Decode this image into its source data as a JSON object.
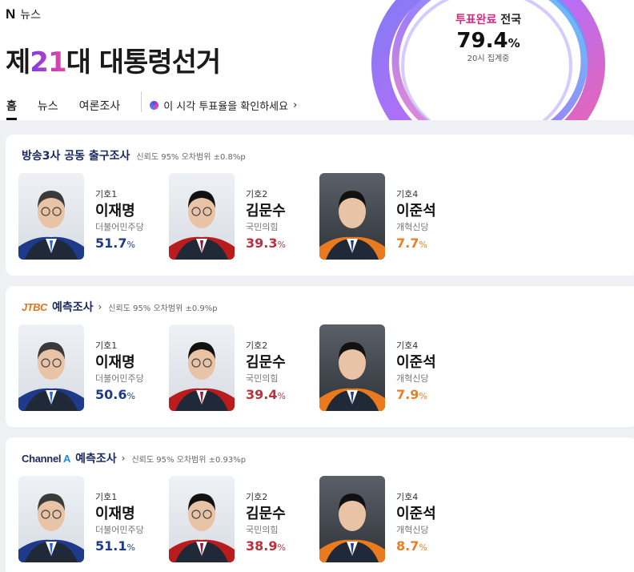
{
  "header": {
    "brand_logo": "N",
    "brand_label": "뉴스",
    "title_prefix": "제",
    "title_number": "21",
    "title_suffix": "대 대통령선거",
    "turnout": {
      "label_accent": "투표완료",
      "label_rest": " 전국",
      "rate": "79.4",
      "rate_unit": "%",
      "status": "20시 집계중"
    },
    "tabs": [
      {
        "label": "홈",
        "active": true
      },
      {
        "label": "뉴스",
        "active": false
      },
      {
        "label": "여론조사",
        "active": false
      }
    ],
    "promo_label": "이 시각 투표율을 확인하세요",
    "promo_arrow": "›"
  },
  "colors": {
    "candidate_1": "#1d3a8f",
    "candidate_2": "#c0303c",
    "candidate_4": "#e87f2a"
  },
  "polls": [
    {
      "source": "방송3사 공동 출구조사",
      "note": "신뢰도 95% 오차범위 ±0.8%p",
      "candidates": [
        {
          "number": "기호1",
          "name": "이재명",
          "party": "더불어민주당",
          "value": "51.7",
          "unit": "%"
        },
        {
          "number": "기호2",
          "name": "김문수",
          "party": "국민의힘",
          "value": "39.3",
          "unit": "%"
        },
        {
          "number": "기호4",
          "name": "이준석",
          "party": "개혁신당",
          "value": "7.7",
          "unit": "%"
        }
      ]
    },
    {
      "logo": "JTBC",
      "source": "예측조사",
      "arrow": "›",
      "note": "신뢰도 95% 오차범위 ±0.9%p",
      "candidates": [
        {
          "number": "기호1",
          "name": "이재명",
          "party": "더불어민주당",
          "value": "50.6",
          "unit": "%"
        },
        {
          "number": "기호2",
          "name": "김문수",
          "party": "국민의힘",
          "value": "39.4",
          "unit": "%"
        },
        {
          "number": "기호4",
          "name": "이준석",
          "party": "개혁신당",
          "value": "7.9",
          "unit": "%"
        }
      ]
    },
    {
      "logo_main": "Channel",
      "logo_mark": "A",
      "source": "예측조사",
      "arrow": "›",
      "note": "신뢰도 95% 오차범위 ±0.93%p",
      "candidates": [
        {
          "number": "기호1",
          "name": "이재명",
          "party": "더불어민주당",
          "value": "51.1",
          "unit": "%"
        },
        {
          "number": "기호2",
          "name": "김문수",
          "party": "국민의힘",
          "value": "38.9",
          "unit": "%"
        },
        {
          "number": "기호4",
          "name": "이준석",
          "party": "개혁신당",
          "value": "8.7",
          "unit": "%"
        }
      ]
    }
  ]
}
